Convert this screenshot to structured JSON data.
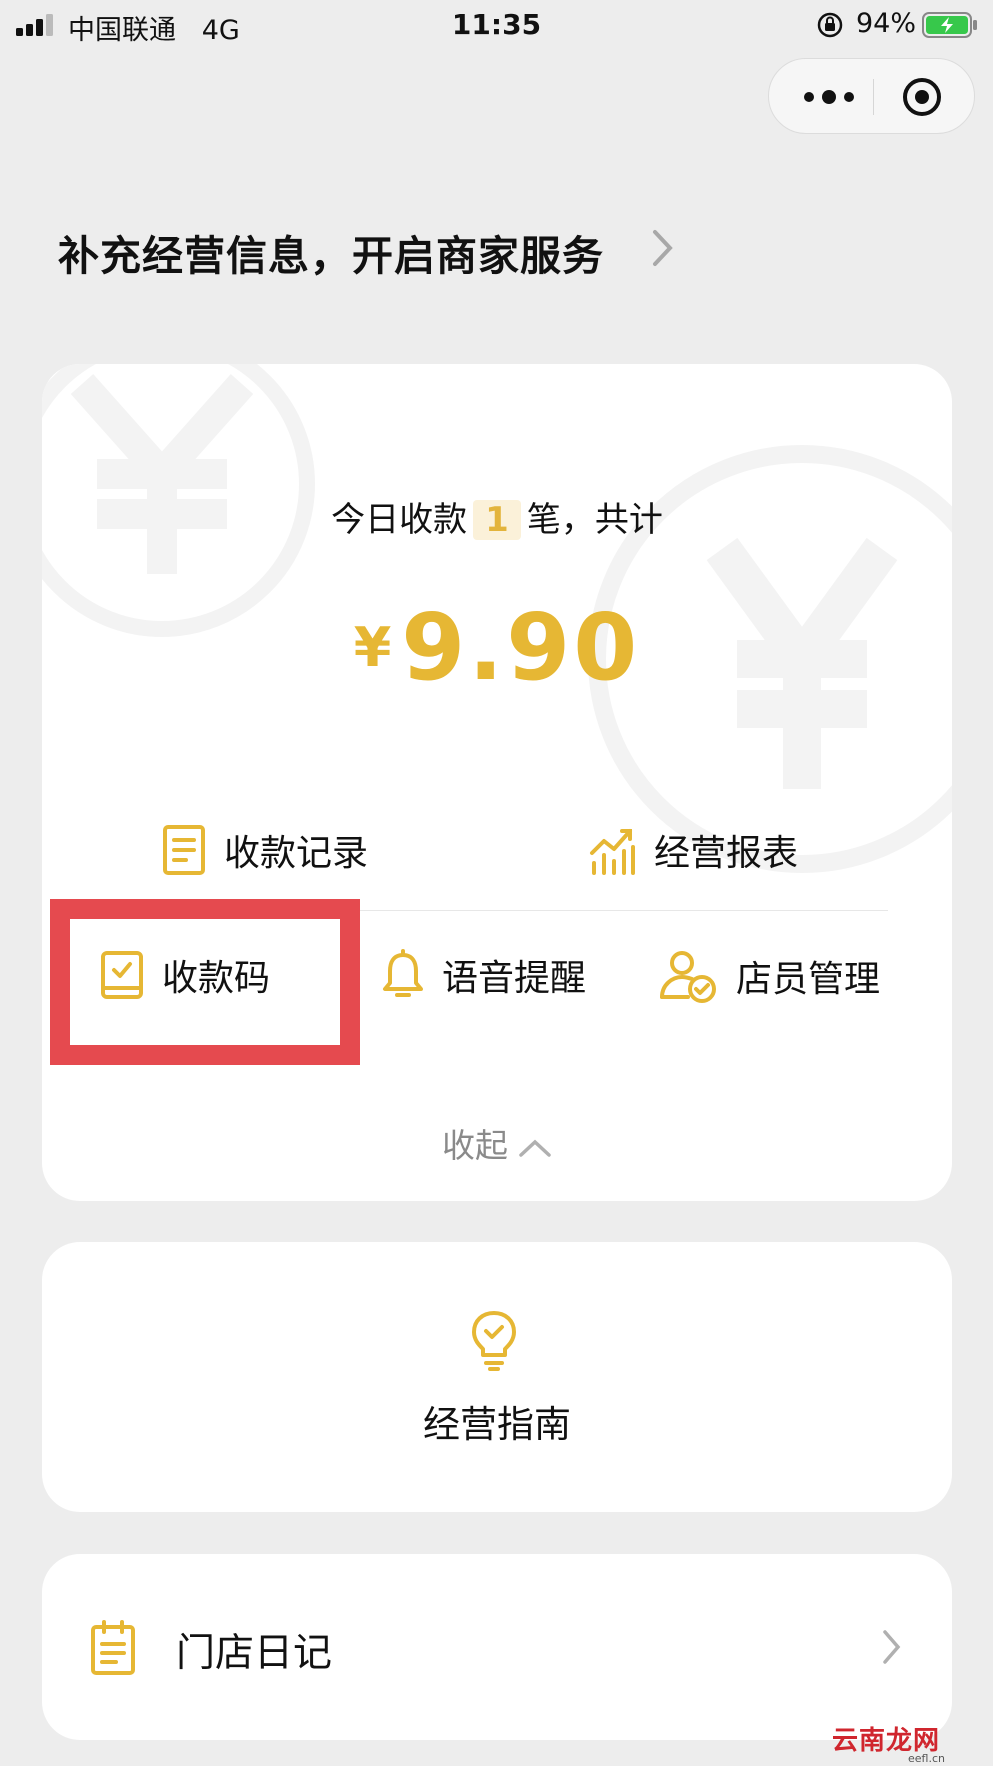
{
  "status_bar": {
    "carrier": "中国联通",
    "network": "4G",
    "time": "11:35",
    "battery": "94%"
  },
  "banner": {
    "text": "补充经营信息，开启商家服务"
  },
  "summary": {
    "prefix": "今日收款",
    "count": "1",
    "suffix": "笔，共计",
    "currency": "¥",
    "amount": "9.90"
  },
  "actions": [
    {
      "label": "收款记录",
      "icon": "receipt-icon"
    },
    {
      "label": "经营报表",
      "icon": "chart-icon"
    },
    {
      "label": "收款码",
      "icon": "qr-book-icon"
    },
    {
      "label": "语音提醒",
      "icon": "bell-icon"
    },
    {
      "label": "店员管理",
      "icon": "staff-icon"
    }
  ],
  "collapse_label": "收起",
  "guide": {
    "label": "经营指南",
    "icon": "lightbulb-icon"
  },
  "diary": {
    "label": "门店日记",
    "icon": "notepad-icon"
  },
  "watermark": {
    "text": "云南龙网",
    "sub": "eefl.cn"
  },
  "colors": {
    "accent": "#e6b734",
    "highlight": "#e54a4f",
    "background": "#ededed"
  }
}
